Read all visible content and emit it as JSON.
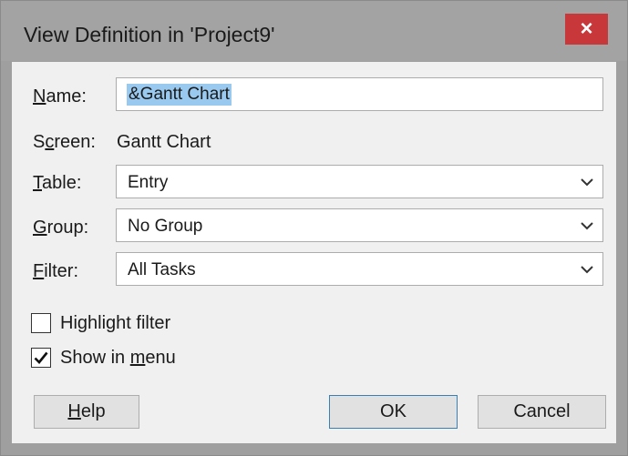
{
  "window": {
    "title": "View Definition in 'Project9'",
    "close_glyph": "×"
  },
  "form": {
    "name": {
      "label_pre": "",
      "label_key": "N",
      "label_post": "ame:",
      "value": "&Gantt Chart"
    },
    "screen": {
      "label_pre": "S",
      "label_key": "c",
      "label_post": "reen:",
      "value": "Gantt Chart"
    },
    "table": {
      "label_pre": "",
      "label_key": "T",
      "label_post": "able:",
      "value": "Entry"
    },
    "group": {
      "label_pre": "",
      "label_key": "G",
      "label_post": "roup:",
      "value": "No Group"
    },
    "filter": {
      "label_pre": "",
      "label_key": "F",
      "label_post": "ilter:",
      "value": "All Tasks"
    }
  },
  "options": {
    "highlight_filter": {
      "label_pre": "Hi",
      "label_key": "g",
      "label_post": "hlight filter",
      "checked": false
    },
    "show_in_menu": {
      "label_pre": "Show in ",
      "label_key": "m",
      "label_post": "enu",
      "checked": true
    }
  },
  "buttons": {
    "help": {
      "label_key": "H",
      "label_post": "elp"
    },
    "ok": {
      "label": "OK"
    },
    "cancel": {
      "label": "Cancel"
    }
  },
  "colors": {
    "close": "#c8373a",
    "selection": "#99c9ef",
    "default_button_border": "#3c7fb1"
  },
  "icons": {
    "close": "close-icon",
    "dropdown": "chevron-down-icon",
    "check": "checkmark-icon"
  }
}
